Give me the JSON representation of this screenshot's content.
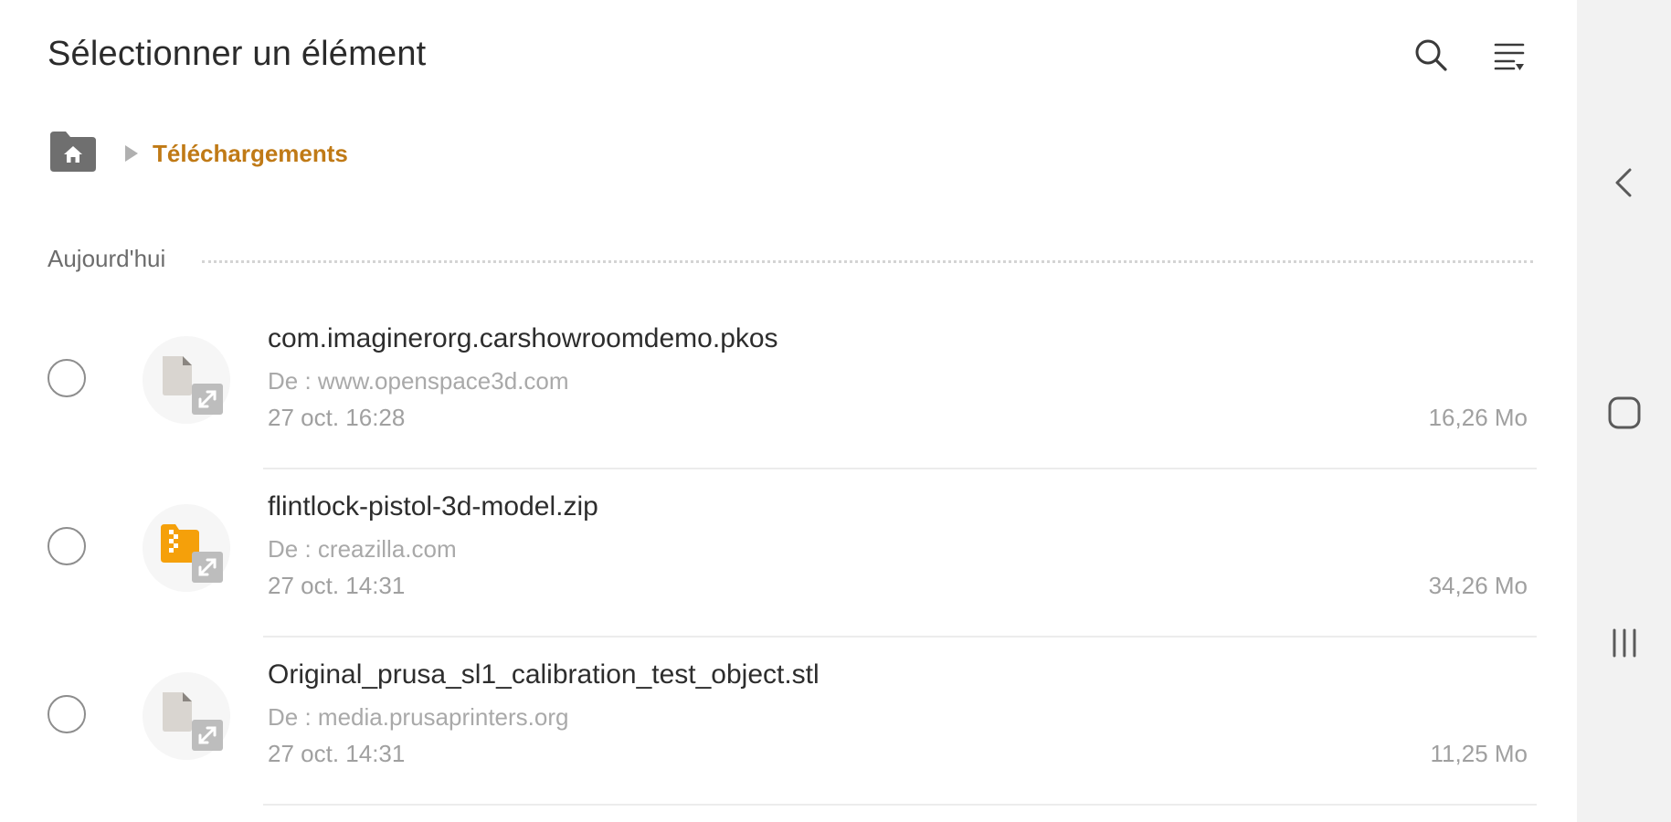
{
  "header": {
    "title": "Sélectionner un élément"
  },
  "breadcrumb": {
    "current": "Téléchargements"
  },
  "section": {
    "label": "Aujourd'hui"
  },
  "files": [
    {
      "name": "com.imaginerorg.carshowroomdemo.pkos",
      "source": "De : www.openspace3d.com",
      "date": "27 oct. 16:28",
      "size": "16,26 Mo",
      "icon": "generic-file-icon"
    },
    {
      "name": "flintlock-pistol-3d-model.zip",
      "source": "De : creazilla.com",
      "date": "27 oct. 14:31",
      "size": "34,26 Mo",
      "icon": "zip-archive-icon"
    },
    {
      "name": "Original_prusa_sl1_calibration_test_object.stl",
      "source": "De : media.prusaprinters.org",
      "date": "27 oct. 14:31",
      "size": "11,25 Mo",
      "icon": "generic-file-icon"
    }
  ],
  "colors": {
    "accent": "#c07a16",
    "zip_icon": "#f5a00a",
    "file_icon": "#d9d5d0",
    "navbar_bg": "#f2f2f2"
  },
  "icons": {
    "search": "search-icon",
    "sort": "sort-icon",
    "home": "home-folder-icon",
    "back": "back-icon",
    "home_nav": "home-nav-icon",
    "recents": "recents-icon"
  }
}
